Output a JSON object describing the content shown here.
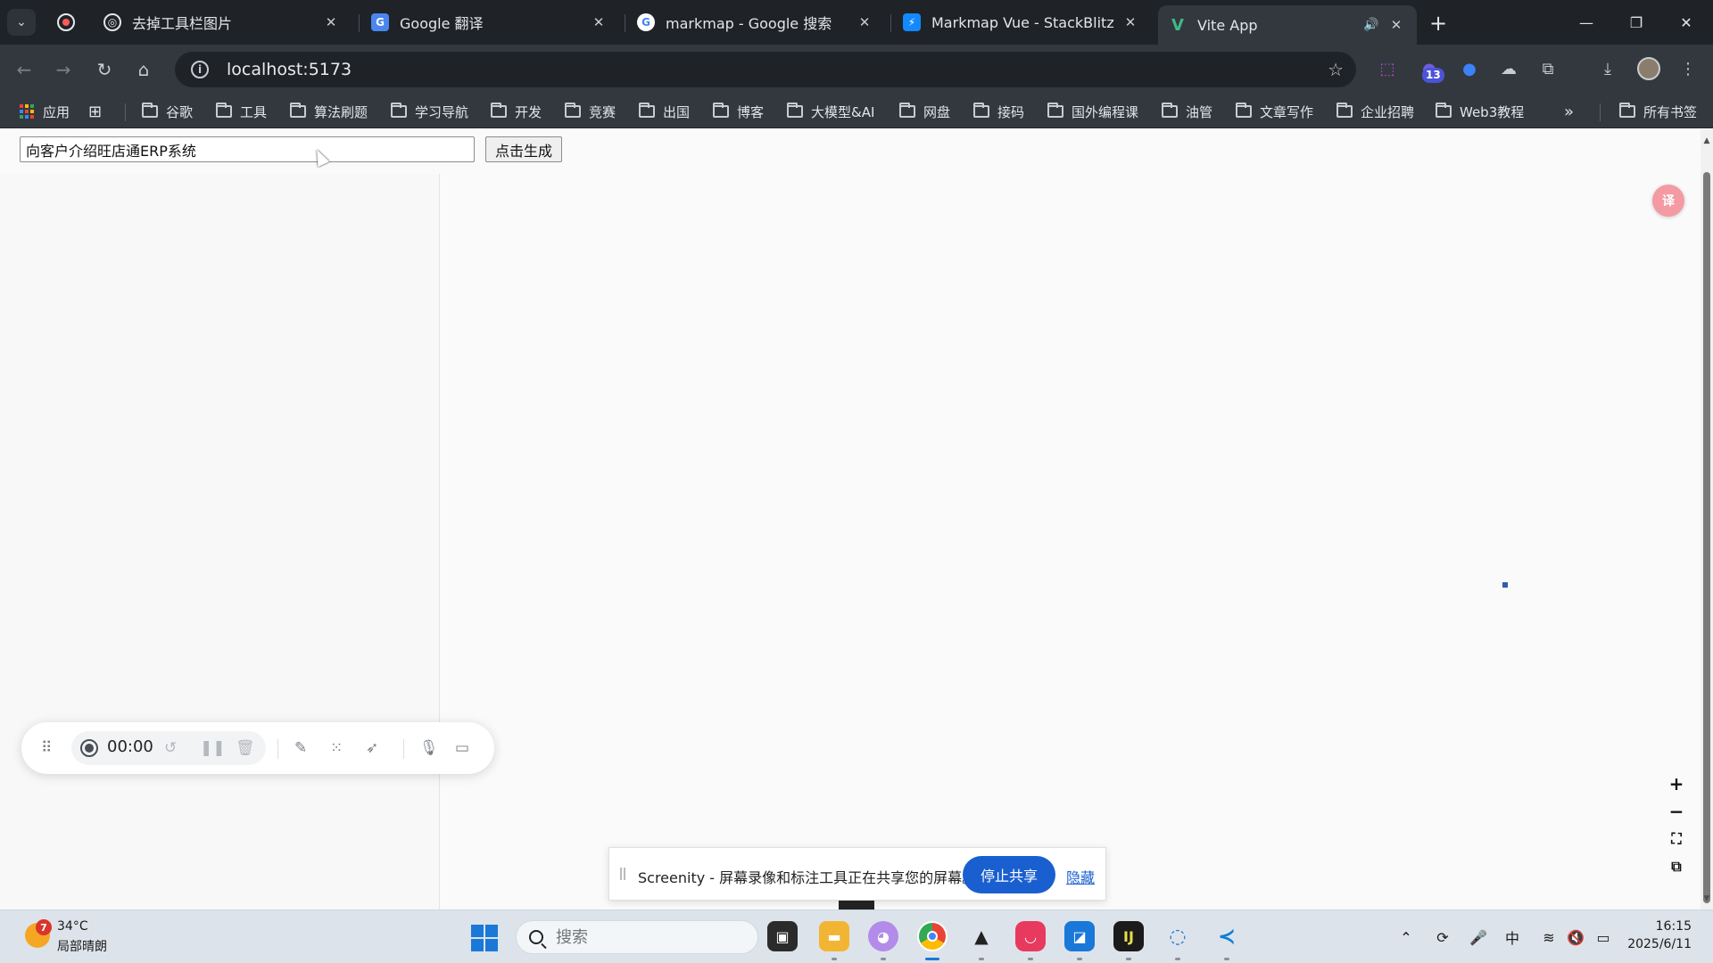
{
  "browser": {
    "tabs": [
      {
        "label": "去掉工具栏图片",
        "favicon": "openai-icon"
      },
      {
        "label": "Google 翻译",
        "favicon": "google-translate-icon"
      },
      {
        "label": "markmap - Google 搜索",
        "favicon": "google-icon"
      },
      {
        "label": "Markmap Vue - StackBlitz",
        "favicon": "stackblitz-icon"
      },
      {
        "label": "Vite App",
        "favicon": "vue-icon",
        "active": true,
        "audio": true
      }
    ],
    "url": "localhost:5173",
    "extension_badge": "13",
    "bookmarks": [
      {
        "label": "应用",
        "icon": "apps-grid-icon"
      },
      {
        "label": "",
        "icon": "tab-groups-icon"
      },
      {
        "label": "谷歌"
      },
      {
        "label": "工具"
      },
      {
        "label": "算法刷题"
      },
      {
        "label": "学习导航"
      },
      {
        "label": "开发"
      },
      {
        "label": "竞赛"
      },
      {
        "label": "出国"
      },
      {
        "label": "博客"
      },
      {
        "label": "大模型&AI"
      },
      {
        "label": "网盘"
      },
      {
        "label": "接码"
      },
      {
        "label": "国外编程课"
      },
      {
        "label": "油管"
      },
      {
        "label": "文章写作"
      },
      {
        "label": "企业招聘"
      },
      {
        "label": "Web3教程"
      }
    ],
    "all_bookmarks_label": "所有书签"
  },
  "app": {
    "topic_input_value": "向客户介绍旺店通ERP系统",
    "generate_button_label": "点击生成"
  },
  "recorder": {
    "time": "00:00"
  },
  "share_banner": {
    "message": "Screenity - 屏幕录像和标注工具正在共享您的屏幕。",
    "stop_label": "停止共享",
    "hide_label": "隐藏"
  },
  "taskbar": {
    "weather_badge": "7",
    "temperature": "34°C",
    "weather_desc": "局部晴朗",
    "search_placeholder": "搜索",
    "ime": "中",
    "time": "16:15",
    "date": "2025/6/11"
  },
  "colors": {
    "browser_frame": "#1f2328",
    "toolbar": "#33383f",
    "accent_blue": "#1a5fd0",
    "markmap_node": "#2e5ea8"
  }
}
